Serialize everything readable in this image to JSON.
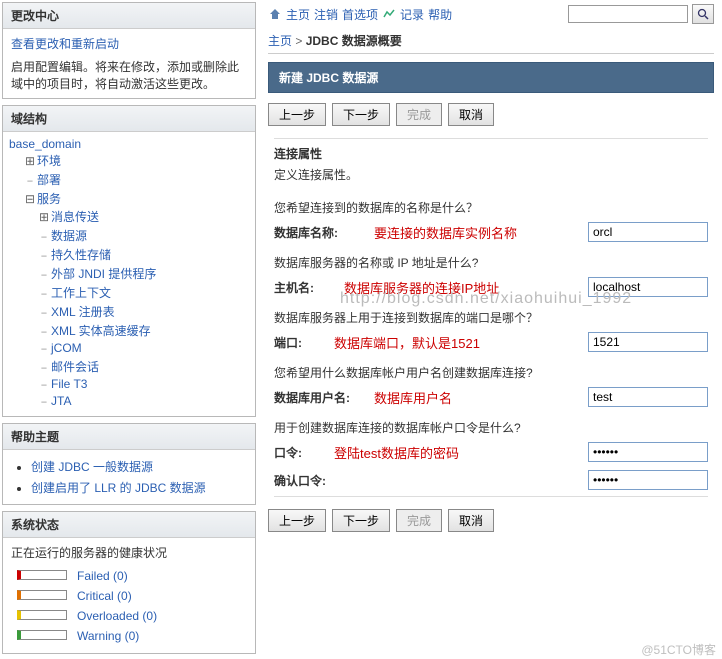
{
  "left": {
    "change_center": {
      "title": "更改中心",
      "link": "查看更改和重新启动",
      "desc": "启用配置编辑。将来在修改，添加或删除此域中的项目时，将自动激活这些更改。"
    },
    "domain_struct": {
      "title": "域结构",
      "root": "base_domain",
      "env": "环境",
      "deploy": "部署",
      "services": "服务",
      "children": [
        "消息传送",
        "数据源",
        "持久性存储",
        "外部 JNDI 提供程序",
        "工作上下文",
        "XML 注册表",
        "XML 实体高速缓存",
        "jCOM",
        "邮件会话",
        "File T3",
        "JTA"
      ]
    },
    "help": {
      "title": "帮助主题",
      "items": [
        "创建 JDBC 一般数据源",
        "创建启用了 LLR 的 JDBC 数据源"
      ]
    },
    "status": {
      "title": "系统状态",
      "subtitle": "正在运行的服务器的健康状况",
      "rows": [
        {
          "label": "Failed",
          "count": 0,
          "color": "red"
        },
        {
          "label": "Critical",
          "count": 0,
          "color": "orange"
        },
        {
          "label": "Overloaded",
          "count": 0,
          "color": "yellow"
        },
        {
          "label": "Warning",
          "count": 0,
          "color": "green"
        }
      ]
    }
  },
  "toolbar": {
    "home": "主页",
    "logout": "注销",
    "prefs": "首选项",
    "record": "记录",
    "help": "帮助"
  },
  "breadcrumb": {
    "home": "主页",
    "current": "JDBC 数据源概要"
  },
  "page_title": "新建 JDBC 数据源",
  "buttons": {
    "back": "上一步",
    "next": "下一步",
    "finish": "完成",
    "cancel": "取消"
  },
  "form": {
    "section_title": "连接属性",
    "section_desc": "定义连接属性。",
    "q_dbname": "您希望连接到的数据库的名称是什么？",
    "lbl_dbname": "数据库名称:",
    "hint_dbname": "要连接的数据库实例名称",
    "val_dbname": "orcl",
    "q_host": "数据库服务器的名称或 IP 地址是什么?",
    "lbl_host": "主机名:",
    "hint_host": "数据库服务器的连接IP地址",
    "val_host": "localhost",
    "q_port": "数据库服务器上用于连接到数据库的端口是哪个？",
    "lbl_port": "端口:",
    "hint_port": "数据库端口，默认是1521",
    "val_port": "1521",
    "q_user": "您希望用什么数据库帐户用户名创建数据库连接?",
    "lbl_user": "数据库用户名:",
    "hint_user": "数据库用户名",
    "val_user": "test",
    "q_pass": "用于创建数据库连接的数据库帐户口令是什么?",
    "lbl_pass": "口令:",
    "hint_pass": "登陆test数据库的密码",
    "val_pass": "••••••",
    "lbl_pass2": "确认口令:",
    "val_pass2": "••••••"
  },
  "watermark": "http://blog.csdn.net/xiaohuihui_1992",
  "footer": "@51CTO博客"
}
